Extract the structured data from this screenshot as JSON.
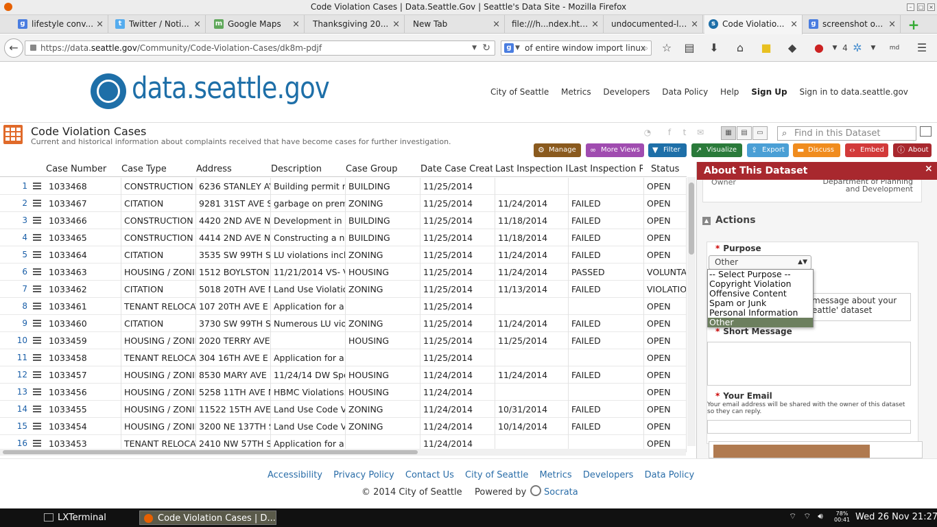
{
  "window": {
    "title": "Code Violation Cases | Data.Seattle.Gov | Seattle's Data Site - Mozilla Firefox"
  },
  "tabs": [
    {
      "label": "lifestyle conv...",
      "icon": "google-icon",
      "active": false
    },
    {
      "label": "Twitter / Noti...",
      "icon": "twitter-icon",
      "active": false
    },
    {
      "label": "Google Maps",
      "icon": "maps-icon",
      "active": false
    },
    {
      "label": "Thanksgiving 20...",
      "icon": "",
      "active": false
    },
    {
      "label": "New Tab",
      "icon": "",
      "active": false
    },
    {
      "label": "file:///h...ndex.html",
      "icon": "",
      "active": false
    },
    {
      "label": "undocumented-li...",
      "icon": "",
      "active": false
    },
    {
      "label": "Code Violatio...",
      "icon": "seattle-icon",
      "active": true
    },
    {
      "label": "screenshot o...",
      "icon": "google-icon",
      "active": false
    }
  ],
  "browser": {
    "url_prefix": "https://data.",
    "url_domain": "seattle.gov",
    "url_path": "/Community/Code-Violation-Cases/dk8m-pdjf",
    "search_value": "of entire window import linux",
    "addon_count": "4",
    "md_label": "md"
  },
  "site": {
    "logo_text": "data.seattle.gov",
    "nav": [
      "City of Seattle",
      "Metrics",
      "Developers",
      "Data Policy",
      "Help"
    ],
    "signup": "Sign Up",
    "signin": "Sign in to data.seattle.gov"
  },
  "dataset": {
    "title": "Code Violation Cases",
    "description": "Current and historical information about complaints received that have become cases for further investigation.",
    "find_placeholder": "Find in this Dataset",
    "actions": [
      {
        "label": "Manage",
        "color": "#8a5a1e"
      },
      {
        "label": "More Views",
        "color": "#a04cb0"
      },
      {
        "label": "Filter",
        "color": "#1e6fa8"
      },
      {
        "label": "Visualize",
        "color": "#2a7a3a"
      },
      {
        "label": "Export",
        "color": "#4a9fd5"
      },
      {
        "label": "Discuss",
        "color": "#f08c1e"
      },
      {
        "label": "Embed",
        "color": "#d23a3a"
      },
      {
        "label": "About",
        "color": "#a8282e"
      }
    ]
  },
  "table": {
    "columns": [
      "Case Number",
      "Case Type",
      "Address",
      "Description",
      "Case Group",
      "Date Case Creat",
      "Last Inspection D",
      "Last Inspection R",
      "Status"
    ],
    "rows": [
      [
        "1",
        "1033468",
        "CONSTRUCTION",
        "6236 STANLEY AV",
        "Building permit re",
        "BUILDING",
        "11/25/2014",
        "",
        "",
        "OPEN"
      ],
      [
        "2",
        "1033467",
        "CITATION",
        "9281 31ST AVE S",
        "garbage on prem",
        "ZONING",
        "11/25/2014",
        "11/24/2014",
        "FAILED",
        "OPEN"
      ],
      [
        "3",
        "1033466",
        "CONSTRUCTION",
        "4420 2ND AVE NW",
        "Development in a",
        "BUILDING",
        "11/25/2014",
        "11/18/2014",
        "FAILED",
        "OPEN"
      ],
      [
        "4",
        "1033465",
        "CONSTRUCTION",
        "4414 2ND AVE NW",
        "Constructing a n",
        "BUILDING",
        "11/25/2014",
        "11/18/2014",
        "FAILED",
        "OPEN"
      ],
      [
        "5",
        "1033464",
        "CITATION",
        "3535 SW 99TH ST",
        "LU violations incl",
        "ZONING",
        "11/25/2014",
        "11/24/2014",
        "FAILED",
        "OPEN"
      ],
      [
        "6",
        "1033463",
        "HOUSING / ZONIN",
        "1512 BOYLSTON A",
        "11/21/2014 VS- V",
        "HOUSING",
        "11/25/2014",
        "11/24/2014",
        "PASSED",
        "VOLUNTAR"
      ],
      [
        "7",
        "1033462",
        "CITATION",
        "5018 20TH AVE N",
        "Land Use Violatio",
        "ZONING",
        "11/25/2014",
        "11/13/2014",
        "FAILED",
        "VIOLATION"
      ],
      [
        "8",
        "1033461",
        "TENANT RELOCAT",
        "107 20TH AVE E",
        "Application for a",
        "",
        "11/25/2014",
        "",
        "",
        "OPEN"
      ],
      [
        "9",
        "1033460",
        "CITATION",
        "3730 SW 99TH ST",
        "Numerous LU vio",
        "ZONING",
        "11/25/2014",
        "11/24/2014",
        "FAILED",
        "OPEN"
      ],
      [
        "10",
        "1033459",
        "HOUSING / ZONIN",
        "2020 TERRY AVE",
        "",
        "HOUSING",
        "11/25/2014",
        "11/25/2014",
        "FAILED",
        "OPEN"
      ],
      [
        "11",
        "1033458",
        "TENANT RELOCAT",
        "304 16TH AVE E",
        "Application for a",
        "",
        "11/25/2014",
        "",
        "",
        "OPEN"
      ],
      [
        "12",
        "1033457",
        "HOUSING / ZONIN",
        "8530 MARY AVE N",
        "11/24/14 DW Spo",
        "HOUSING",
        "11/24/2014",
        "11/24/2014",
        "FAILED",
        "OPEN"
      ],
      [
        "13",
        "1033456",
        "HOUSING / ZONIN",
        "5258 11TH AVE N",
        "HBMC Violations.",
        "HOUSING",
        "11/24/2014",
        "",
        "",
        "OPEN"
      ],
      [
        "14",
        "1033455",
        "HOUSING / ZONIN",
        "11522 15TH AVE",
        "Land Use Code V",
        "ZONING",
        "11/24/2014",
        "10/31/2014",
        "FAILED",
        "OPEN"
      ],
      [
        "15",
        "1033454",
        "HOUSING / ZONIN",
        "3200 NE 137TH S",
        "Land Use Code V",
        "ZONING",
        "11/24/2014",
        "10/14/2014",
        "FAILED",
        "OPEN"
      ],
      [
        "16",
        "1033453",
        "TENANT RELOCAT",
        "2410 NW 57TH S",
        "Application for a",
        "",
        "11/24/2014",
        "",
        "",
        "OPEN"
      ]
    ]
  },
  "panel": {
    "title": "About This Dataset",
    "owner_label": "Owner",
    "owner_value_1": "Department of Planning",
    "owner_value_2": "and Development",
    "actions_label": "Actions",
    "purpose_label": "Purpose",
    "purpose_value": "Other",
    "purpose_options": [
      "-- Select Purpose --",
      "Copyright Violation",
      "Offensive Content",
      "Spam or Junk",
      "Personal Information",
      "Other"
    ],
    "message_text_1": "message about your",
    "message_text_2": "eattle' dataset",
    "short_message_label": "Short Message",
    "email_label": "Your Email",
    "email_note": "Your email address will be shared with the owner of this dataset so they can reply."
  },
  "footer": {
    "links": [
      "Accessibility",
      "Privacy Policy",
      "Contact Us",
      "City of Seattle",
      "Metrics",
      "Developers",
      "Data Policy"
    ],
    "copyright": "© 2014 City of Seattle",
    "powered_by": "Powered by",
    "brand": "Socrata"
  },
  "taskbar": {
    "items": [
      "LXTerminal",
      "Code Violation Cases | D..."
    ],
    "battery_percent": "78%",
    "battery_time": "00:41",
    "clock": "Wed 26 Nov 21:27"
  }
}
